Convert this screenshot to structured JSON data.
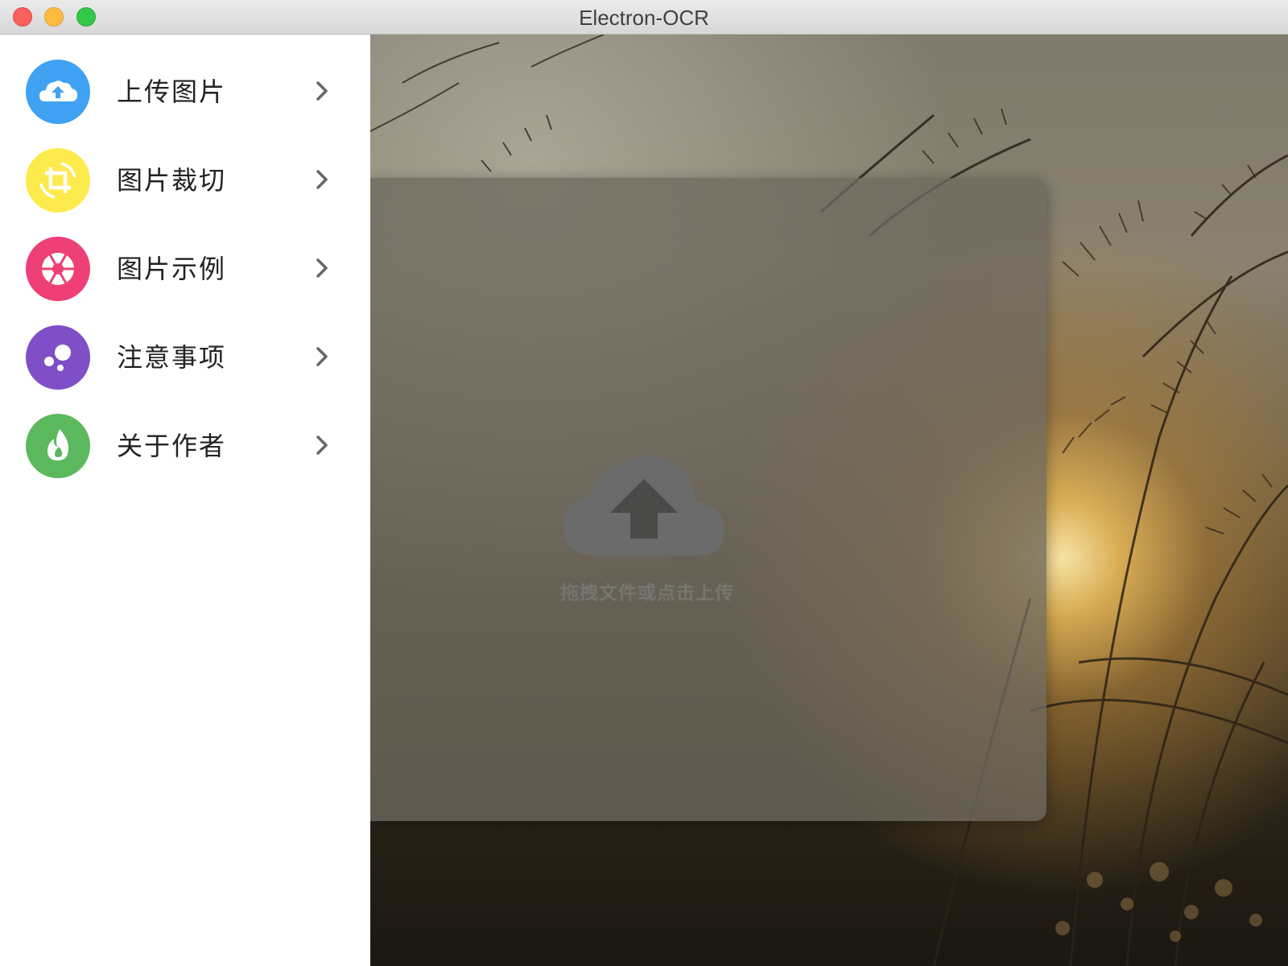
{
  "window": {
    "title": "Electron-OCR"
  },
  "sidebar": {
    "items": [
      {
        "label": "上传图片",
        "icon": "cloud-upload-icon",
        "color": "#3fa2f2"
      },
      {
        "label": "图片裁切",
        "icon": "crop-rotate-icon",
        "color": "#fdeb4d"
      },
      {
        "label": "图片示例",
        "icon": "aperture-icon",
        "color": "#ee3f76"
      },
      {
        "label": "注意事项",
        "icon": "bubbles-icon",
        "color": "#7e4fc6"
      },
      {
        "label": "关于作者",
        "icon": "flame-icon",
        "color": "#5cb85c"
      }
    ]
  },
  "main": {
    "upload_hint": "拖拽文件或点击上传",
    "upload_icon": "cloud-upload-icon"
  },
  "colors": {
    "titlebar": "#e2e2e2",
    "sidebar_bg": "#ffffff",
    "panel_overlay": "#6e695f",
    "cloud_icon": "#6b6b6b"
  }
}
